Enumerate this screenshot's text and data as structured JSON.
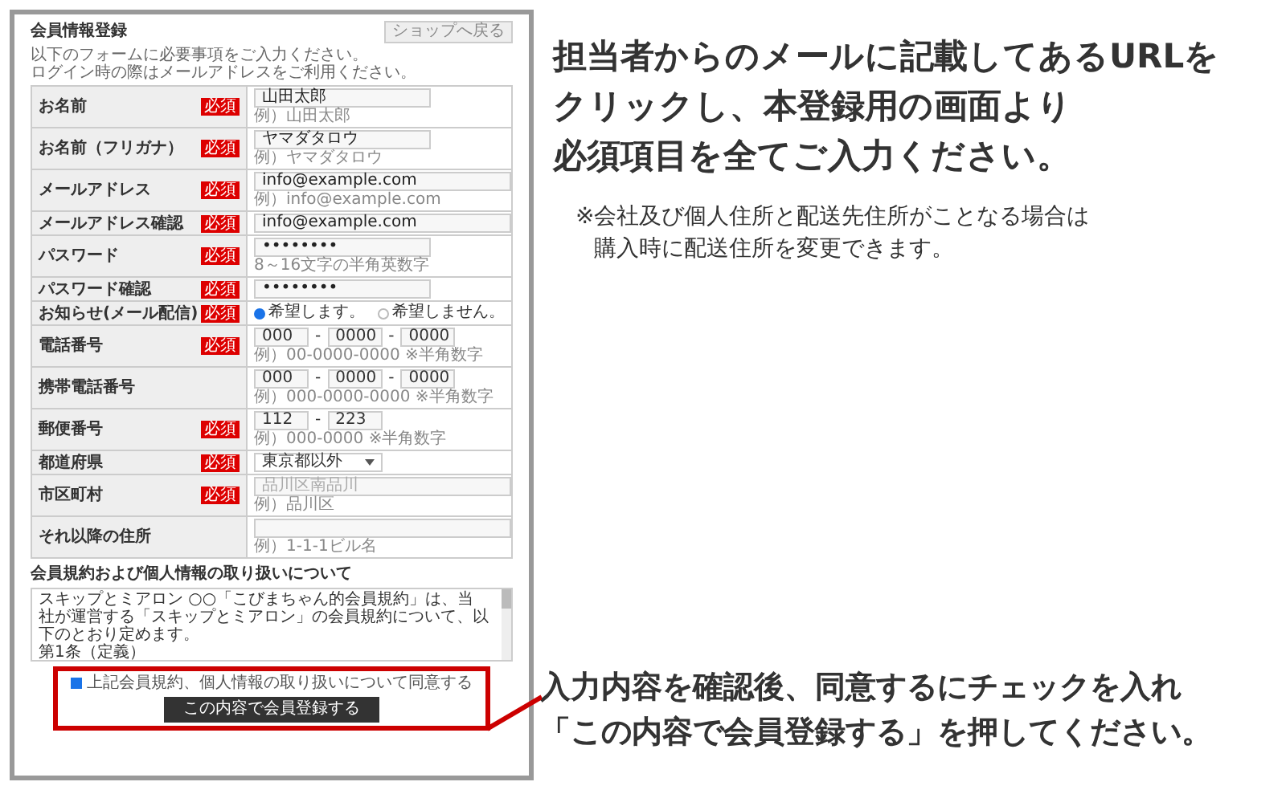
{
  "form": {
    "title": "会員情報登録",
    "back_button": "ショップへ戻る",
    "intro": [
      "以下のフォームに必要事項をご入力ください。",
      "ログイン時の際はメールアドレスをご利用ください。"
    ],
    "rows": [
      {
        "label": "お名前",
        "badge": "必須",
        "kind": "text",
        "value": "山田太郎",
        "wide": false,
        "hint": "例）山田太郎"
      },
      {
        "label": "お名前（フリガナ）",
        "badge": "必須",
        "kind": "text",
        "value": "ヤマダタロウ",
        "wide": false,
        "hint": "例）ヤマダタロウ"
      },
      {
        "label": "メールアドレス",
        "badge": "必須",
        "kind": "text",
        "value": "info@example.com",
        "hint": "例）info@example.com",
        "wide": true
      },
      {
        "label": "メールアドレス確認",
        "badge": "必須",
        "kind": "text",
        "value": "info@example.com",
        "wide": true
      },
      {
        "label": "パスワード",
        "badge": "必須",
        "kind": "text",
        "value": "••••••••",
        "wide": false,
        "hint": "8～16文字の半角英数字"
      },
      {
        "label": "パスワード確認",
        "badge": "必須",
        "kind": "text",
        "value": "••••••••",
        "wide": false
      },
      {
        "label": "お知らせ(メール配信)",
        "badge": "必須",
        "kind": "radio",
        "options": [
          {
            "label": "希望します。",
            "selected": true
          },
          {
            "label": "希望しません。",
            "selected": false
          }
        ]
      },
      {
        "label": "電話番号",
        "badge": "必須",
        "kind": "parts",
        "parts": [
          "000",
          "0000",
          "0000"
        ],
        "separator": "-",
        "hint": "例）00-0000-0000 ※半角数字"
      },
      {
        "label": "携帯電話番号",
        "kind": "parts",
        "parts": [
          "000",
          "0000",
          "0000"
        ],
        "separator": "-",
        "hint": "例）000-0000-0000 ※半角数字"
      },
      {
        "label": "郵便番号",
        "badge": "必須",
        "kind": "parts",
        "parts": [
          "112",
          "223"
        ],
        "separator": "-",
        "hint": "例）000-0000 ※半角数字"
      },
      {
        "label": "都道府県",
        "badge": "必須",
        "kind": "select",
        "value": "東京都以外"
      },
      {
        "label": "市区町村",
        "badge": "必須",
        "kind": "text",
        "placeholder": "品川区南品川",
        "hint": "例）品川区",
        "wide": true
      },
      {
        "label": "それ以降の住所",
        "kind": "text",
        "hint": "例）1-1-1ビル名",
        "wide": true
      }
    ],
    "policy": {
      "heading": "会員規約および個人情報の取り扱いについて",
      "paragraphs": [
        "スキップとミアロン ○○「こびまちゃん的会員規約」は、当社が運営する「スキップとミアロン」の会員規約について、以下のとおり定めます。",
        "第1条（定義）"
      ]
    },
    "agreement": {
      "label": "上記会員規約、個人情報の取り扱いについて同意する",
      "checked": true
    },
    "submit": "この内容で会員登録する"
  },
  "instructions": {
    "heading_lines": [
      "担当者からのメールに記載してあるURLを",
      "クリックし、本登録用の画面より",
      "必須項目を全てご入力ください。"
    ],
    "note": {
      "mark": "※",
      "lines": [
        "会社及び個人住所と配送先住所がことなる場合は",
        "購入時に配送住所を変更できます。"
      ]
    },
    "bottom_lines": [
      "入力内容を確認後、同意するにチェックを入れ",
      "「この内容で会員登録する」を押してください。"
    ]
  }
}
